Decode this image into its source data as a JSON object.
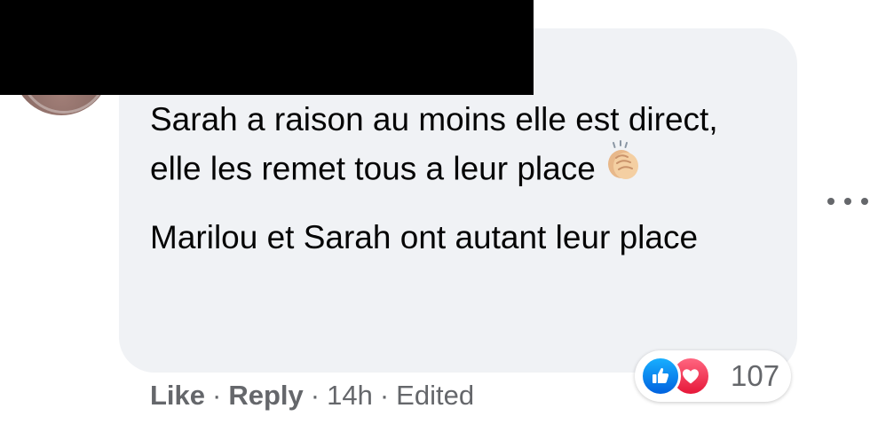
{
  "comment": {
    "paragraphs": [
      "Sarah a raison au moins elle est direct, elle les remet tous a leur place",
      "Marilou et Sarah ont autant leur place"
    ],
    "emoji": "clapping-hands"
  },
  "actions": {
    "like_label": "Like",
    "reply_label": "Reply",
    "separator": "·",
    "time": "14h",
    "edited_label": "Edited"
  },
  "reactions": {
    "types": [
      "like",
      "love"
    ],
    "count": "107"
  },
  "colors": {
    "bubble_bg": "#f0f2f5",
    "text": "#050505",
    "secondary_text": "#65676b",
    "like_blue": "#0866ff",
    "love_red": "#f33e58",
    "redaction": "#000000"
  }
}
